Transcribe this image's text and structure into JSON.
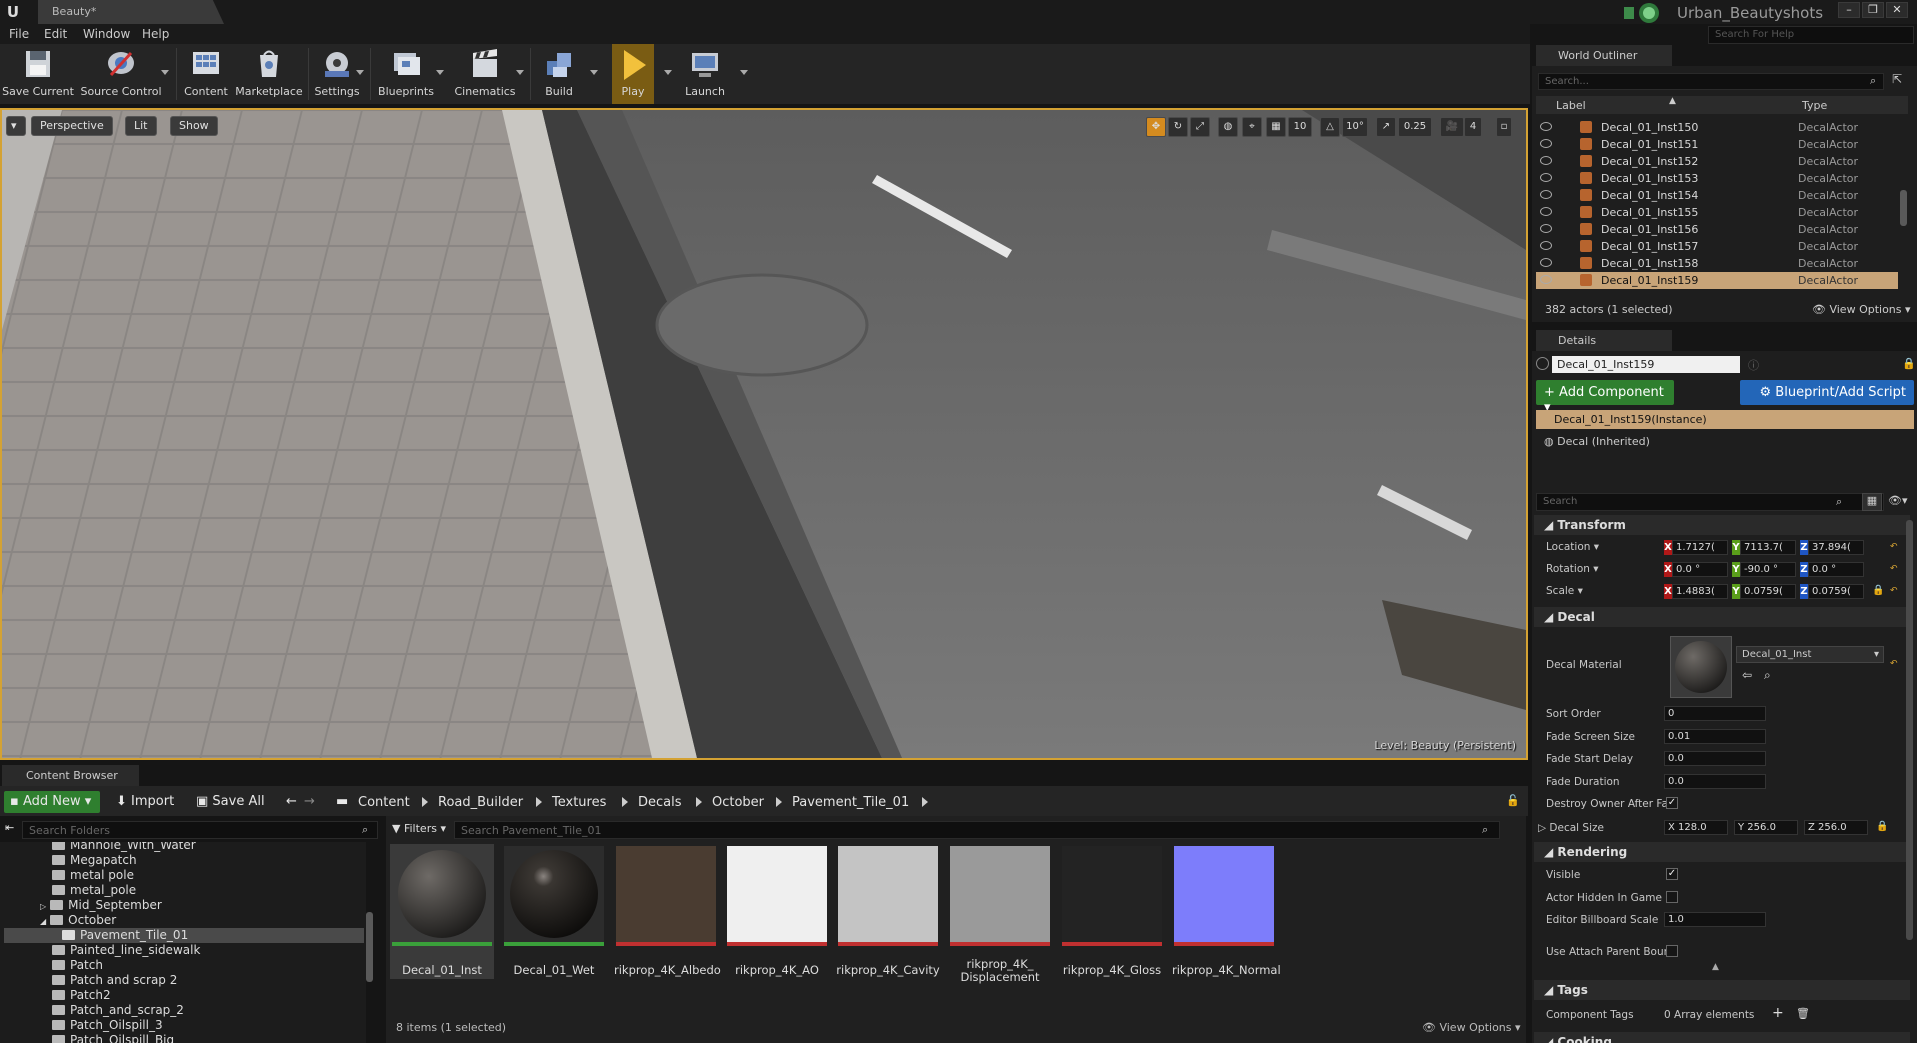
{
  "window": {
    "tab_title": "Beauty*",
    "project_name": "Urban_Beautyshots",
    "help_search_placeholder": "Search For Help"
  },
  "menu": [
    "File",
    "Edit",
    "Window",
    "Help"
  ],
  "toolbar": [
    {
      "label": "Save Current",
      "icon": "save-icon"
    },
    {
      "label": "Source Control",
      "icon": "source-control-icon"
    },
    {
      "label": "Content",
      "icon": "content-icon"
    },
    {
      "label": "Marketplace",
      "icon": "marketplace-icon"
    },
    {
      "label": "Settings",
      "icon": "settings-icon"
    },
    {
      "label": "Blueprints",
      "icon": "blueprints-icon"
    },
    {
      "label": "Cinematics",
      "icon": "cinematics-icon"
    },
    {
      "label": "Build",
      "icon": "build-icon"
    },
    {
      "label": "Play",
      "icon": "play-icon"
    },
    {
      "label": "Launch",
      "icon": "launch-icon"
    }
  ],
  "viewport": {
    "view_mode_label": "Perspective",
    "lit_label": "Lit",
    "show_label": "Show",
    "grid_snap": "10",
    "rotation_snap": "10°",
    "scale_snap": "0.25",
    "camera_speed": "4",
    "level_prefix": "Level:",
    "level_name": "Beauty (Persistent)"
  },
  "content_browser": {
    "tab_title": "Content Browser",
    "add_new_label": "Add New",
    "import_label": "Import",
    "save_all_label": "Save All",
    "breadcrumbs": [
      "Content",
      "Road_Builder",
      "Textures",
      "Decals",
      "October",
      "Pavement_Tile_01"
    ],
    "folder_search_placeholder": "Search Folders",
    "filters_label": "Filters",
    "asset_search_placeholder": "Search Pavement_Tile_01",
    "folders": [
      {
        "name": "Manhole_With_Water",
        "indent": 1
      },
      {
        "name": "Megapatch",
        "indent": 1
      },
      {
        "name": "metal pole",
        "indent": 1
      },
      {
        "name": "metal_pole",
        "indent": 1
      },
      {
        "name": "Mid_September",
        "indent": 1,
        "collapsed": true
      },
      {
        "name": "October",
        "indent": 1,
        "expanded": true
      },
      {
        "name": "Pavement_Tile_01",
        "indent": 2,
        "selected": true
      },
      {
        "name": "Painted_line_sidewalk",
        "indent": 1
      },
      {
        "name": "Patch",
        "indent": 1
      },
      {
        "name": "Patch and scrap 2",
        "indent": 1
      },
      {
        "name": "Patch2",
        "indent": 1
      },
      {
        "name": "Patch_and_scrap_2",
        "indent": 1
      },
      {
        "name": "Patch_Oilspill_3",
        "indent": 1
      },
      {
        "name": "Patch_Oilspill_Big",
        "indent": 1
      }
    ],
    "assets": [
      {
        "label": "Decal_01_Inst",
        "kind": "material-instance",
        "selected": true
      },
      {
        "label": "Decal_01_Wet",
        "kind": "material"
      },
      {
        "label": "rikprop_4K_Albedo",
        "kind": "texture",
        "color": "#4a3c31"
      },
      {
        "label": "rikprop_4K_AO",
        "kind": "texture",
        "color": "#efefef"
      },
      {
        "label": "rikprop_4K_Cavity",
        "kind": "texture",
        "color": "#c4c4c4"
      },
      {
        "label": "rikprop_4K_ Displacement",
        "kind": "texture",
        "color": "#9a9a9a"
      },
      {
        "label": "rikprop_4K_Gloss",
        "kind": "texture",
        "color": "#232323"
      },
      {
        "label": "rikprop_4K_Normal",
        "kind": "texture",
        "color": "#7d7dfb"
      }
    ],
    "items_count": "8 items (1 selected)",
    "view_options": "View Options"
  },
  "outliner": {
    "tab_title": "World Outliner",
    "search_placeholder": "Search...",
    "col_label": "Label",
    "col_type": "Type",
    "rows": [
      {
        "label": "Decal_01_Inst150",
        "type": "DecalActor"
      },
      {
        "label": "Decal_01_Inst151",
        "type": "DecalActor"
      },
      {
        "label": "Decal_01_Inst152",
        "type": "DecalActor"
      },
      {
        "label": "Decal_01_Inst153",
        "type": "DecalActor"
      },
      {
        "label": "Decal_01_Inst154",
        "type": "DecalActor"
      },
      {
        "label": "Decal_01_Inst155",
        "type": "DecalActor"
      },
      {
        "label": "Decal_01_Inst156",
        "type": "DecalActor"
      },
      {
        "label": "Decal_01_Inst157",
        "type": "DecalActor"
      },
      {
        "label": "Decal_01_Inst158",
        "type": "DecalActor"
      },
      {
        "label": "Decal_01_Inst159",
        "type": "DecalActor",
        "selected": true
      }
    ],
    "actor_count": "382 actors (1 selected)",
    "view_options": "View Options"
  },
  "details": {
    "tab_title": "Details",
    "actor_name": "Decal_01_Inst159",
    "add_component_label": "+ Add Component",
    "blueprint_label": "Blueprint/Add Script",
    "instance_label": "Decal_01_Inst159(Instance)",
    "inherited_label": "Decal (Inherited)",
    "search_placeholder": "Search",
    "transform": {
      "title": "Transform",
      "location_label": "Location",
      "rotation_label": "Rotation",
      "scale_label": "Scale",
      "location": [
        "1.7127(",
        "7113.7(",
        "37.894("
      ],
      "rotation": [
        "0.0 °",
        "-90.0 °",
        "0.0 °"
      ],
      "scale": [
        "1.4883(",
        "0.0759(",
        "0.0759("
      ]
    },
    "decal": {
      "title": "Decal",
      "material_label": "Decal Material",
      "material_value": "Decal_01_Inst",
      "sort_order_label": "Sort Order",
      "sort_order": "0",
      "fade_screen_size_label": "Fade Screen Size",
      "fade_screen_size": "0.01",
      "fade_start_delay_label": "Fade Start Delay",
      "fade_start_delay": "0.0",
      "fade_duration_label": "Fade Duration",
      "fade_duration": "0.0",
      "destroy_owner_label": "Destroy Owner After Fa",
      "destroy_owner": true,
      "decal_size_label": "Decal Size",
      "decal_size": [
        "128.0",
        "256.0",
        "256.0"
      ]
    },
    "rendering": {
      "title": "Rendering",
      "visible_label": "Visible",
      "visible": true,
      "hidden_in_game_label": "Actor Hidden In Game",
      "hidden_in_game": false,
      "billboard_scale_label": "Editor Billboard Scale",
      "billboard_scale": "1.0",
      "attach_parent_label": "Use Attach Parent Boun",
      "attach_parent": false
    },
    "tags": {
      "title": "Tags",
      "component_tags_label": "Component Tags",
      "component_tags_value": "0 Array elements"
    },
    "cooking_title": "Cooking"
  }
}
